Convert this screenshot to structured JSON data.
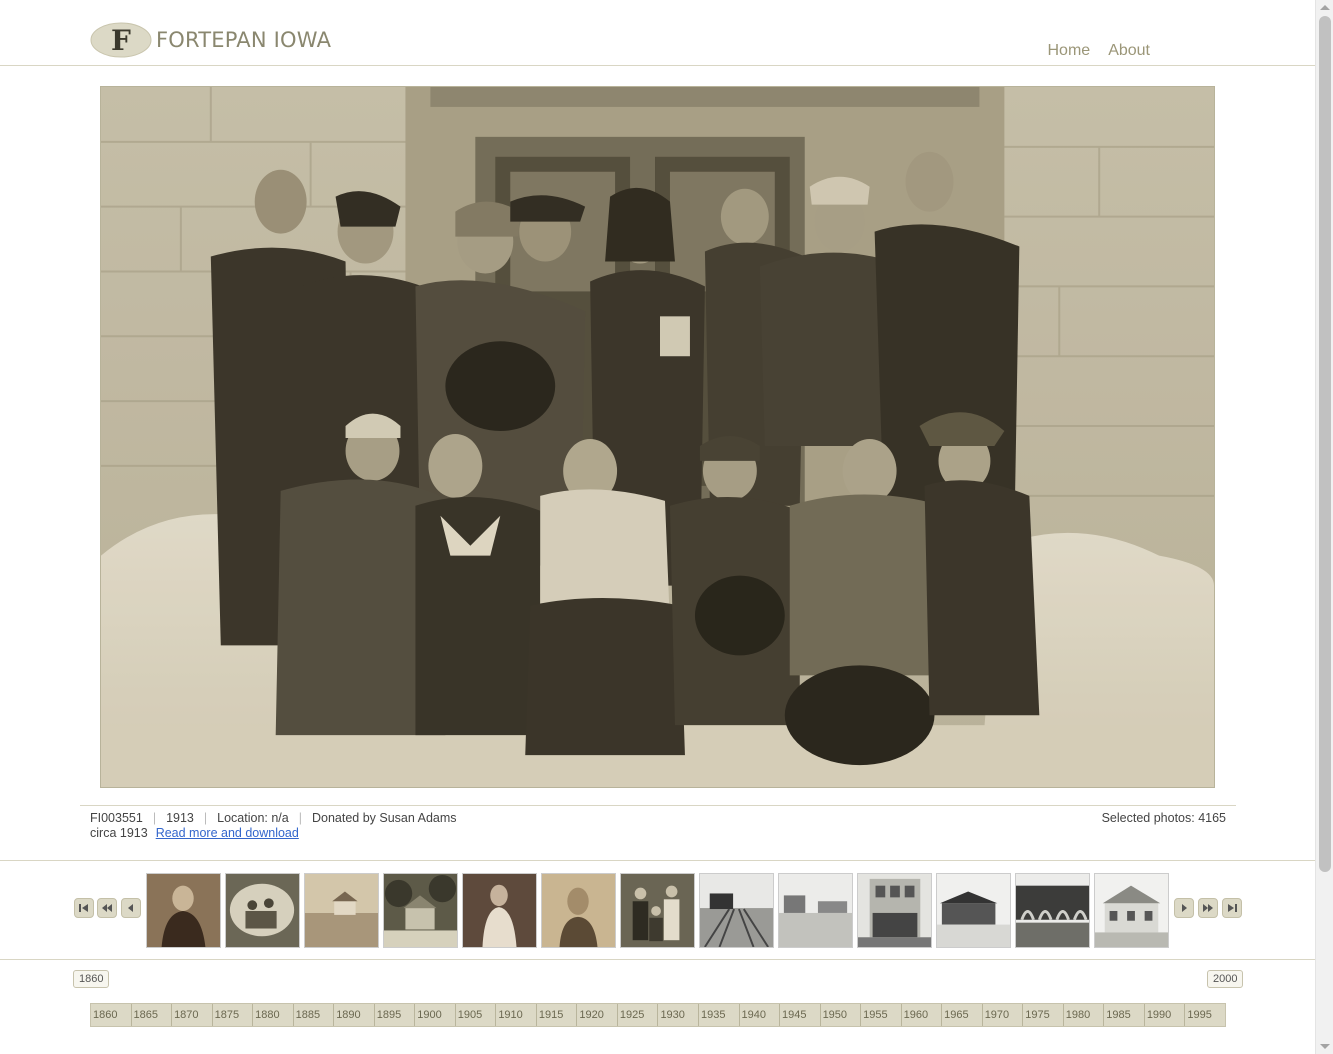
{
  "header": {
    "logo_letter": "F",
    "logo_text": "FORTEPAN IOWA",
    "nav": [
      "Home",
      "About"
    ]
  },
  "photo": {
    "id": "FI003551",
    "year": "1913",
    "location": "Location: n/a",
    "donor": "Donated by Susan Adams",
    "date_note": "circa 1913",
    "read_more": "Read more and download",
    "selected": "Selected photos: 4165"
  },
  "thumbnails": [
    {
      "icon": "portrait-man-icon"
    },
    {
      "icon": "oval-family-portrait-icon"
    },
    {
      "icon": "farmhouse-landscape-icon"
    },
    {
      "icon": "house-with-trees-icon"
    },
    {
      "icon": "portrait-woman-icon"
    },
    {
      "icon": "portrait-man-sepia-icon"
    },
    {
      "icon": "group-family-icon"
    },
    {
      "icon": "railroad-tracks-icon"
    },
    {
      "icon": "town-street-icon"
    },
    {
      "icon": "storefront-building-icon"
    },
    {
      "icon": "depot-building-icon"
    },
    {
      "icon": "arched-building-icon"
    },
    {
      "icon": "white-house-icon"
    }
  ],
  "timeline": {
    "start_label": "1860",
    "end_label": "2000",
    "ticks": [
      "1860",
      "1865",
      "1870",
      "1875",
      "1880",
      "1885",
      "1890",
      "1895",
      "1900",
      "1905",
      "1910",
      "1915",
      "1920",
      "1925",
      "1930",
      "1935",
      "1940",
      "1945",
      "1950",
      "1955",
      "1960",
      "1965",
      "1970",
      "1975",
      "1980",
      "1985",
      "1990",
      "1995"
    ]
  },
  "colors": {
    "accent": "#9b9678",
    "timeline_bg": "#dcd9c6",
    "link": "#3366cc"
  }
}
